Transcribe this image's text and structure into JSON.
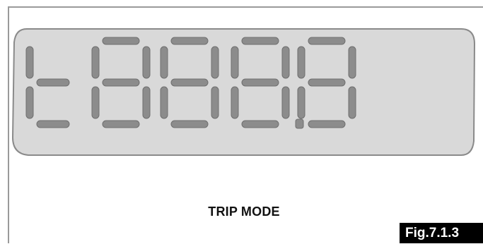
{
  "display": {
    "digits": [
      "t",
      "8",
      "8",
      "8",
      "8"
    ],
    "decimal_after_index": 3,
    "colors": {
      "panel_fill": "#d9d9d9",
      "panel_border": "#8a8a8a",
      "segment_fill": "#8c8c8c",
      "segment_edge": "#6f6f6f"
    }
  },
  "caption": "TRIP MODE",
  "figure_label": "Fig.7.1.3"
}
